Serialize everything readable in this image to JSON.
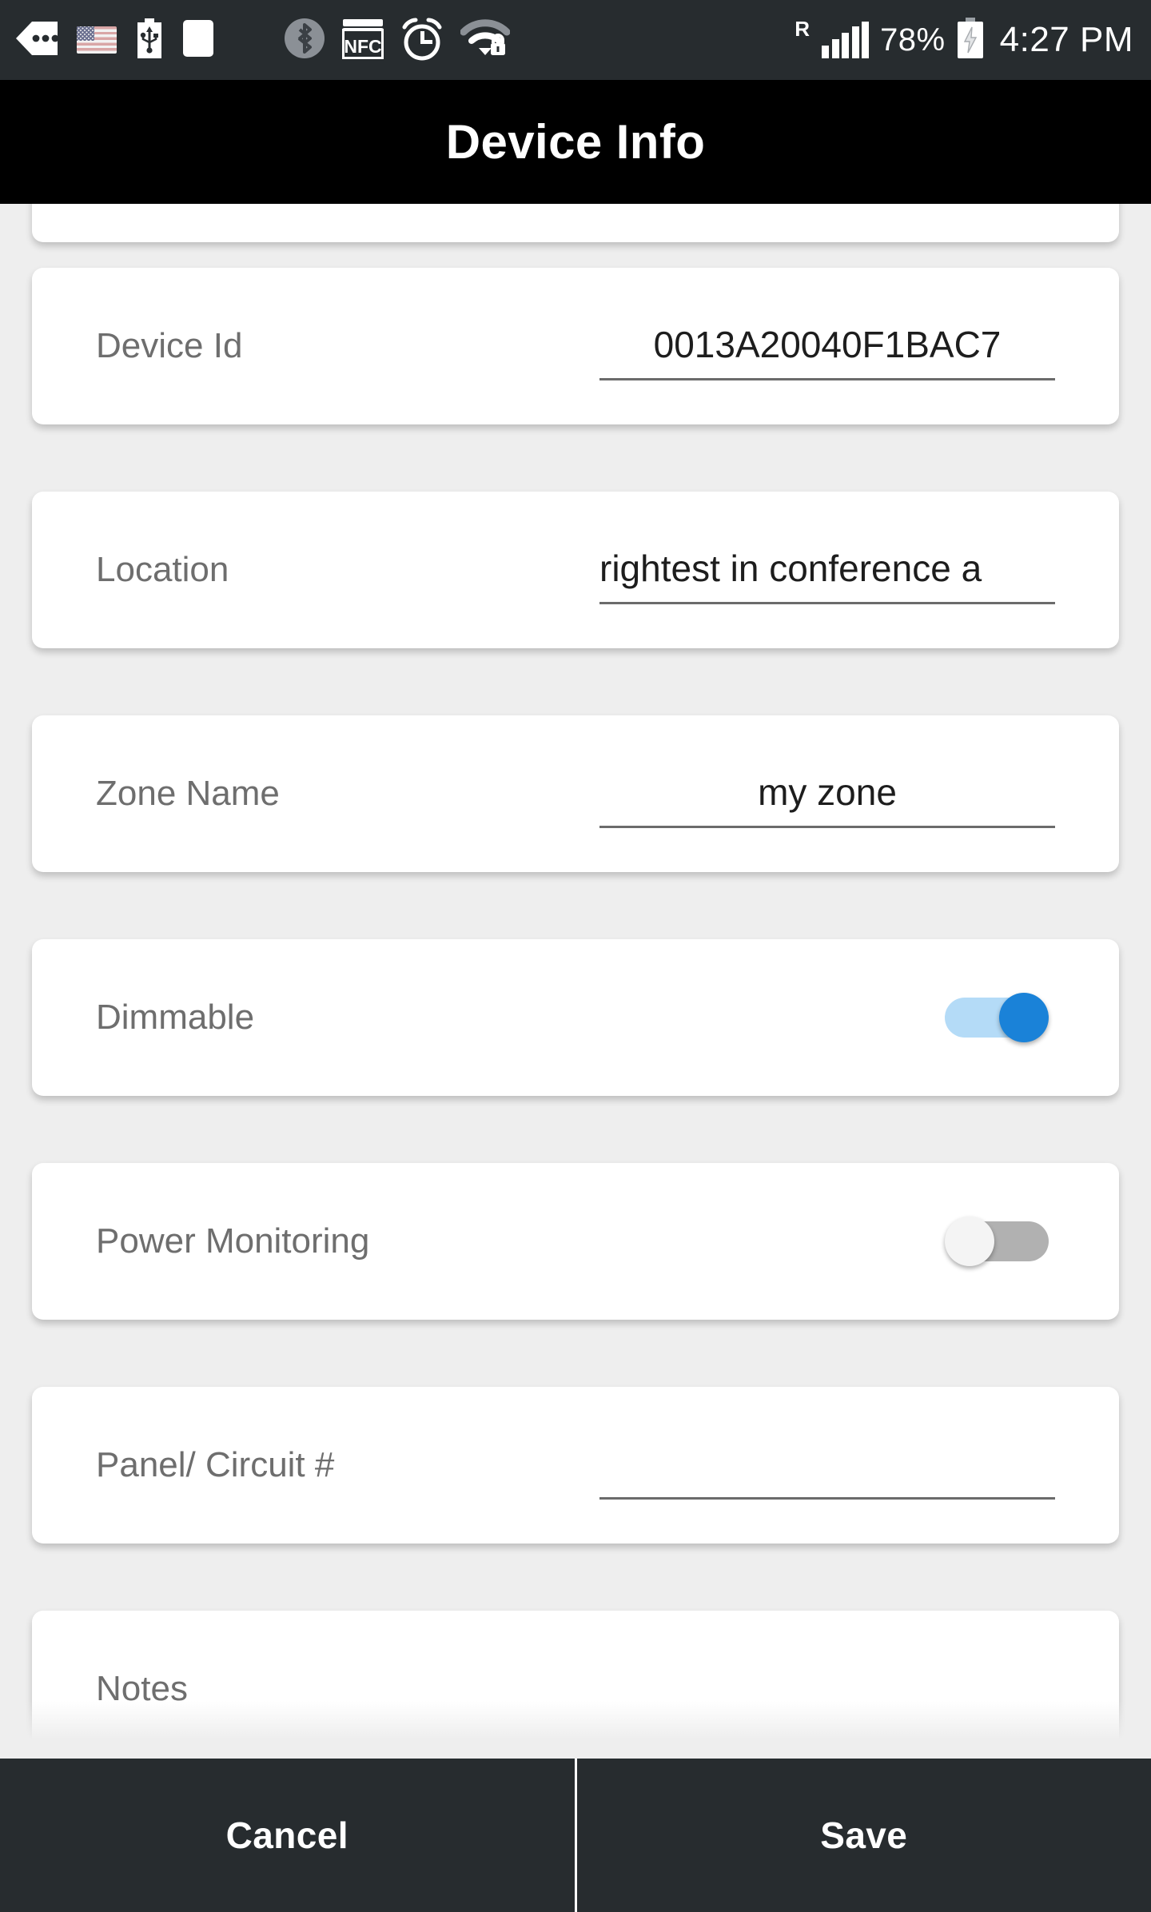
{
  "statusbar": {
    "icons_left": [
      "notifications-more-icon",
      "us-flag-icon",
      "usb-icon",
      "blank-card-icon"
    ],
    "icons_mid": [
      "bluetooth-icon",
      "nfc-icon",
      "alarm-clock-icon",
      "wifi-secure-icon"
    ],
    "roaming_label": "R",
    "signal_icon": "cellular-signal-icon",
    "battery_percent": "78%",
    "battery_icon": "battery-charging-icon",
    "time": "4:27 PM"
  },
  "header": {
    "title": "Device Info"
  },
  "form": {
    "fields": [
      {
        "label": "Device Id",
        "value": "0013A20040F1BAC7",
        "placeholder": "",
        "type": "text",
        "clip": false
      },
      {
        "label": "Location",
        "value": "rightest in conference a",
        "placeholder": "",
        "type": "text",
        "clip": true
      },
      {
        "label": "Zone Name",
        "value": "my zone",
        "placeholder": "",
        "type": "text",
        "clip": false
      },
      {
        "label": "Dimmable",
        "value": "on",
        "placeholder": "",
        "type": "toggle",
        "clip": false
      },
      {
        "label": "Power Monitoring",
        "value": "off",
        "placeholder": "",
        "type": "toggle",
        "clip": false
      },
      {
        "label": "Panel/ Circuit #",
        "value": "",
        "placeholder": "",
        "type": "text",
        "clip": false
      },
      {
        "label": "Notes",
        "value": "",
        "placeholder": "",
        "type": "text",
        "clip": false
      }
    ]
  },
  "footer": {
    "cancel_label": "Cancel",
    "save_label": "Save"
  },
  "colors": {
    "status_bar": "#272c2f",
    "title_bar": "#000000",
    "page_bg": "#eeeeee",
    "card_bg": "#ffffff",
    "label_text": "#6e6e6e",
    "value_text": "#1d1d1d",
    "toggle_on_thumb": "#1a82d8",
    "toggle_on_track": "#b4dbf7",
    "toggle_off_track": "#b1b1b1",
    "toggle_off_thumb": "#f4f4f4",
    "footer_button": "#272c2f"
  }
}
